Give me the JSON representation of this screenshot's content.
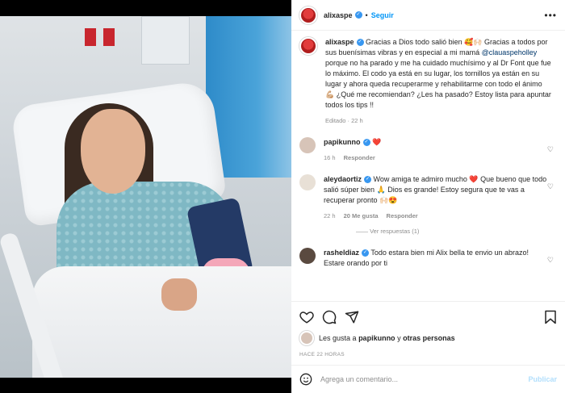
{
  "header": {
    "username": "alixaspe",
    "follow_label": "Seguir",
    "separator": "•"
  },
  "caption": {
    "username": "alixaspe",
    "text_before": " Gracias a Dios todo salió bien 🥰🙌🏻 Gracias a todos por sus buenísimas vibras y en especial a mi mamá ",
    "mention": "@clauaspeholley",
    "text_after": " porque no ha parado y me ha cuidado muchísimo y al Dr Font que fue lo máximo. El codo ya está en su lugar, los tornillos ya están en su lugar y ahora queda recuperarme y rehabilitarme con todo el ánimo 💪🏼 ¿Qué me recomiendan? ¿Les ha pasado? Estoy lista para apuntar todos los tips !!",
    "edited": "Editado · 22 h"
  },
  "comments": [
    {
      "username": "papikunno",
      "text": " ❤️",
      "time": "16 h",
      "reply_label": "Responder",
      "likes": "",
      "avatar_color": "#d7c4b8"
    },
    {
      "username": "aleydaortiz",
      "text": " Wow amiga te admiro mucho ❤️ Que bueno que todo salió súper bien 🙏 Dios es grande! Estoy segura que te vas a recuperar pronto 🙌🏻😍",
      "time": "22 h",
      "likes": "20 Me gusta",
      "reply_label": "Responder",
      "avatar_color": "#e8e0d6"
    },
    {
      "username": "rasheldiaz",
      "text": " Todo estara bien mi Alix bella te envio un abrazo! Estare orando por ti",
      "time": "",
      "likes": "",
      "reply_label": "",
      "avatar_color": "#5a4a40"
    }
  ],
  "view_replies": "Ver respuestas (1)",
  "likes": {
    "prefix": "Les gusta a ",
    "user": "papikunno",
    "middle": " y ",
    "others": "otras personas"
  },
  "timestamp": "HACE 22 HORAS",
  "add_comment": {
    "placeholder": "Agrega un comentario...",
    "publish_label": "Publicar"
  },
  "icons": [
    "heart-icon",
    "comment-icon",
    "share-icon",
    "bookmark-icon",
    "emoji-icon",
    "more-icon"
  ],
  "colors": {
    "link": "#0095f6",
    "verified": "#3897f0",
    "muted": "#8e8e8e",
    "publish_disabled": "#b2dffc"
  }
}
